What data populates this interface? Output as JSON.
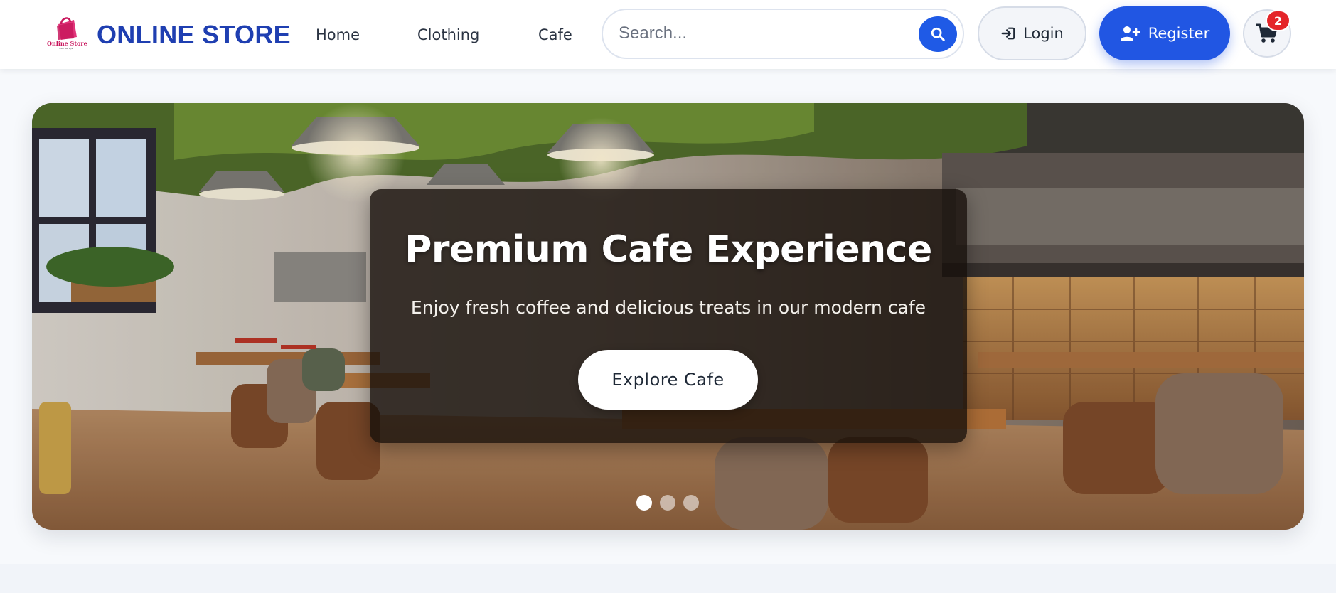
{
  "header": {
    "logo_text": "Online Store",
    "logo_tagline": "Shop with style",
    "brand": "ONLINE STORE",
    "nav": {
      "home": "Home",
      "clothing": "Clothing",
      "cafe": "Cafe"
    },
    "search": {
      "placeholder": "Search...",
      "value": ""
    },
    "login_label": "Login",
    "register_label": "Register",
    "cart_count": "2"
  },
  "hero": {
    "title": "Premium Cafe Experience",
    "subtitle": "Enjoy fresh coffee and delicious treats in our modern cafe",
    "cta_label": "Explore Cafe",
    "slides_total": 3,
    "active_slide": 1
  },
  "icons": {
    "logo": "shopping-bag-icon",
    "search": "search-icon",
    "login": "sign-in-icon",
    "register": "user-plus-icon",
    "cart": "shopping-cart-icon"
  },
  "colors": {
    "brand": "#1f3fb1",
    "primary": "#2156e3",
    "badge": "#e4252a",
    "logo_pink": "#c8175d"
  }
}
